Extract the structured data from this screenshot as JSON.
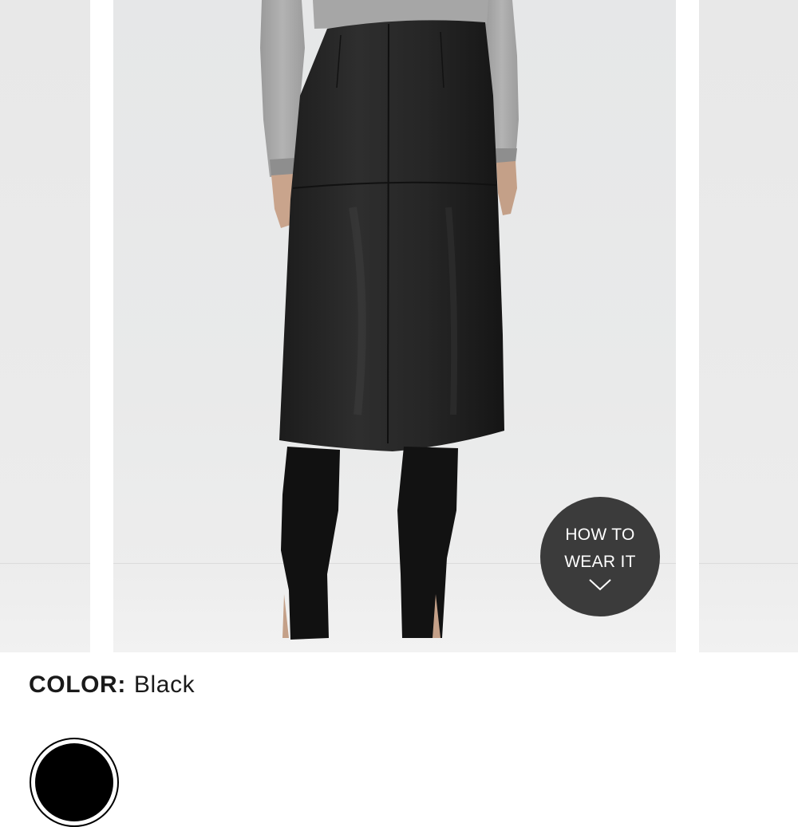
{
  "gallery": {
    "how_to_wear": {
      "line1": "HOW TO",
      "line2": "WEAR IT"
    }
  },
  "product": {
    "color_label": "COLOR:",
    "color_value": "Black",
    "swatches": [
      {
        "color": "#000000",
        "selected": true
      }
    ]
  },
  "icons": {
    "zoom": "zoom-in-icon",
    "how_to_wear_arrow": "chevron-down-icon"
  }
}
